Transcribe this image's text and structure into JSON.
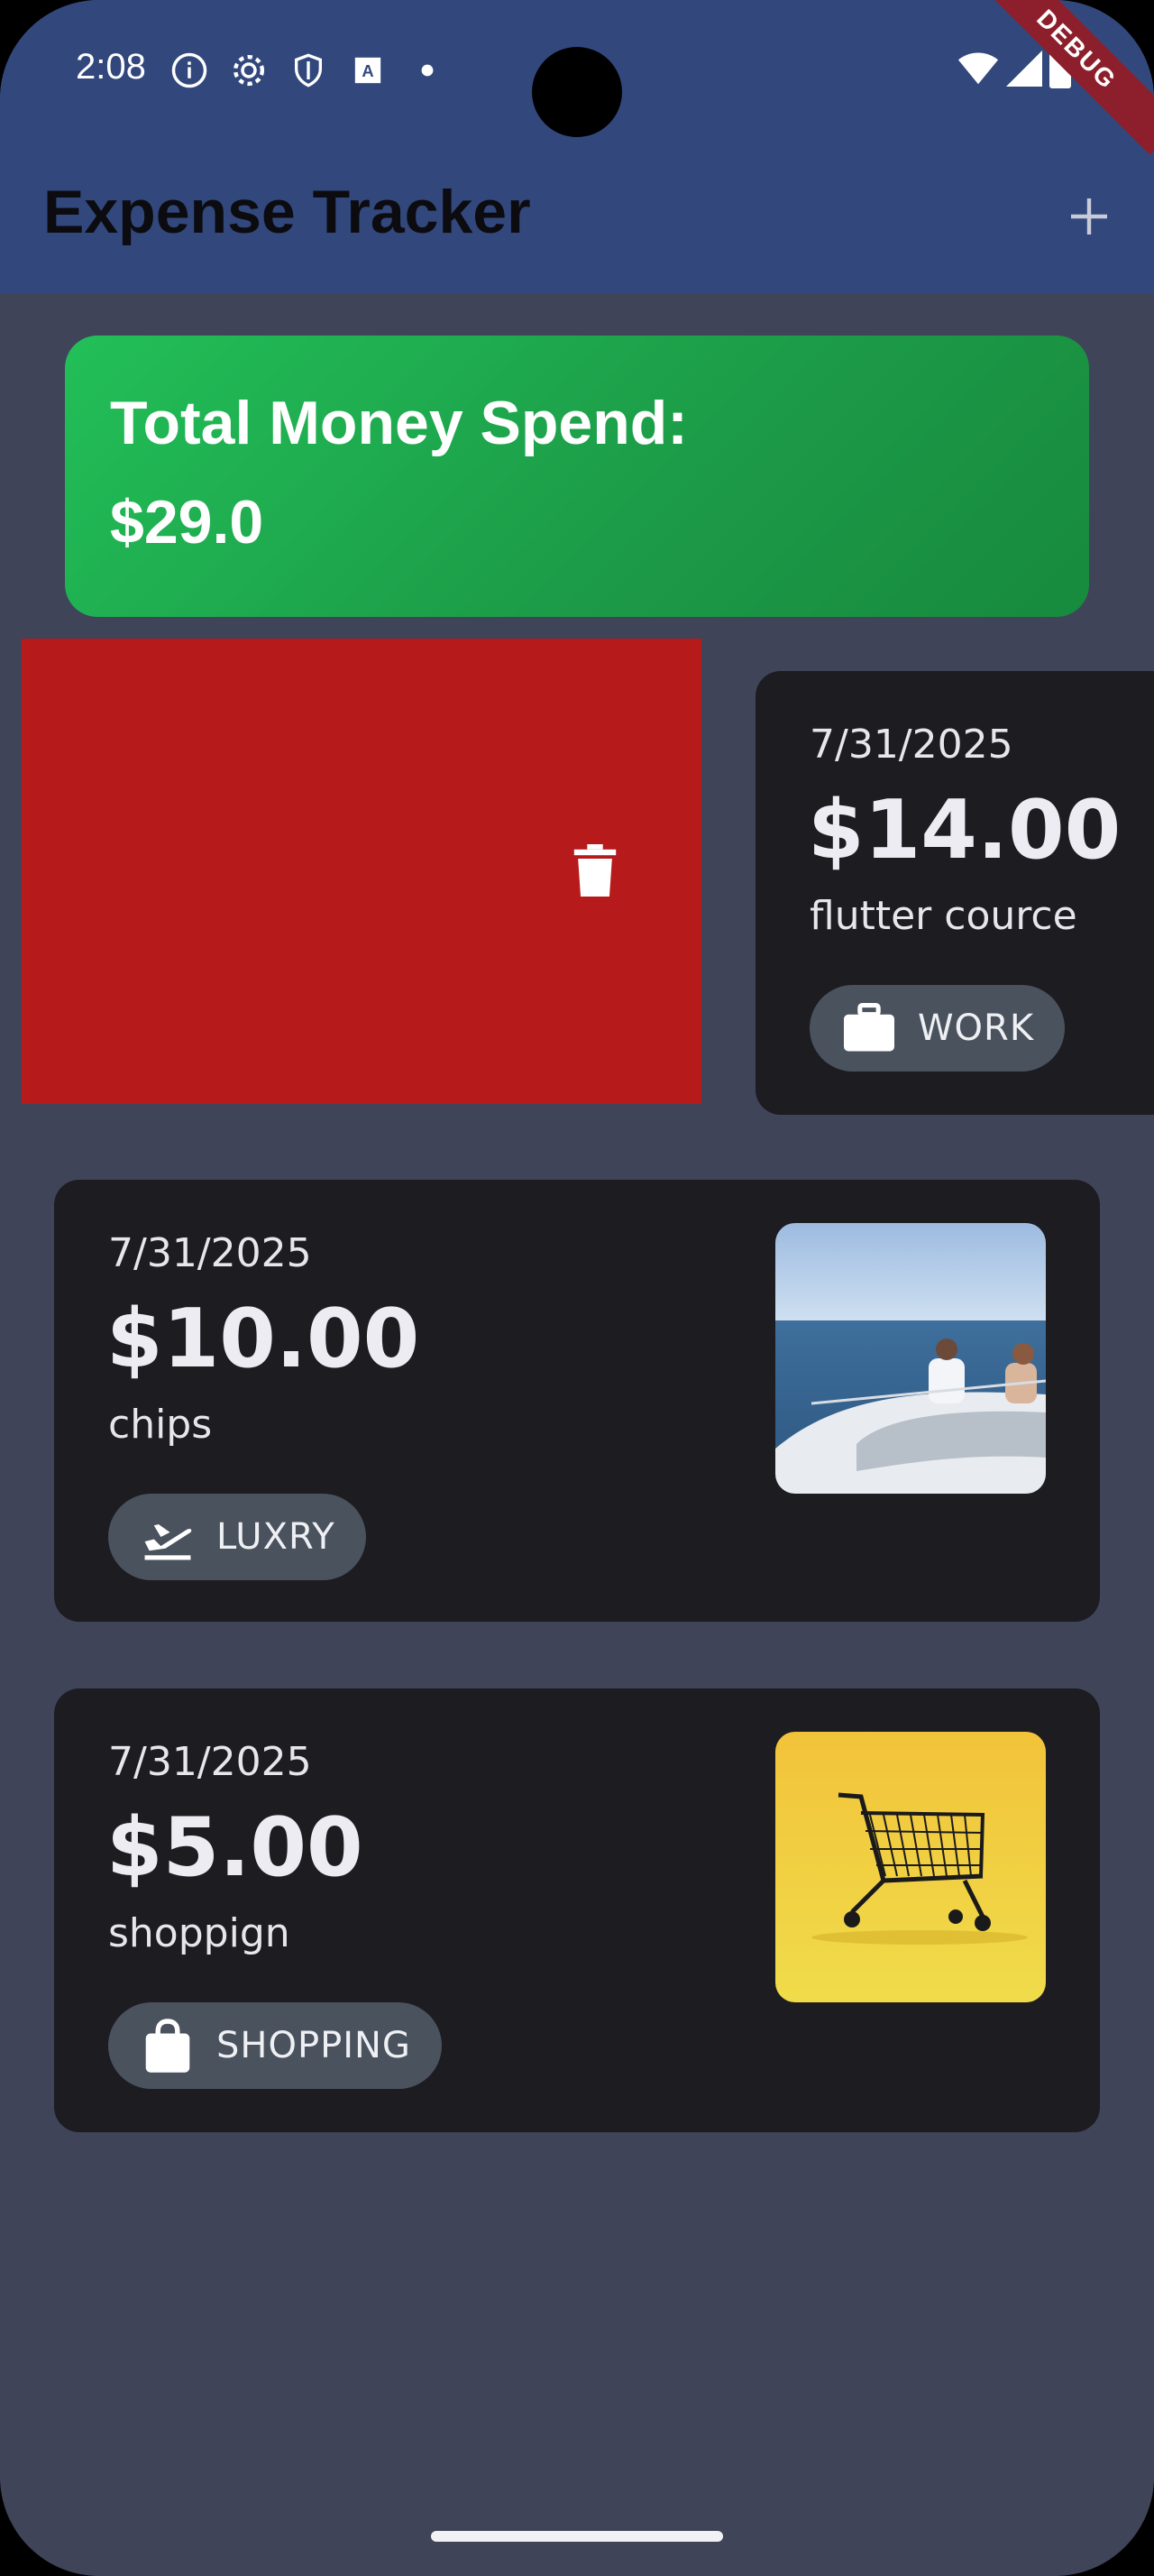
{
  "status_bar": {
    "time": "2:08",
    "icons": [
      "info-icon",
      "settings-icon",
      "shield-icon",
      "font-icon",
      "dot-icon"
    ],
    "right_icons": [
      "wifi-icon",
      "signal-icon",
      "battery-icon"
    ],
    "debug_label": "DEBUG"
  },
  "app_bar": {
    "title": "Expense Tracker",
    "add_icon": "plus-icon"
  },
  "summary": {
    "label": "Total Money Spend:",
    "value": "$29.0"
  },
  "swipe_action": {
    "icon": "trash-icon",
    "color": "#b71a1a"
  },
  "expenses": [
    {
      "date": "7/31/2025",
      "amount": "$14.00",
      "title": "flutter cource",
      "category": "WORK",
      "category_icon": "briefcase-icon"
    },
    {
      "date": "7/31/2025",
      "amount": "$10.00",
      "title": "chips",
      "category": "LUXRY",
      "category_icon": "flight-takeoff-icon",
      "image": "yacht-photo"
    },
    {
      "date": "7/31/2025",
      "amount": "$5.00",
      "title": "shoppign",
      "category": "SHOPPING",
      "category_icon": "shopping-bag-icon",
      "image": "shopping-cart-photo"
    }
  ],
  "colors": {
    "app_bar": "#32487d",
    "background": "#3f4459",
    "card": "#1c1c21",
    "summary_green": "#22bf58",
    "chip": "#4a525e"
  }
}
